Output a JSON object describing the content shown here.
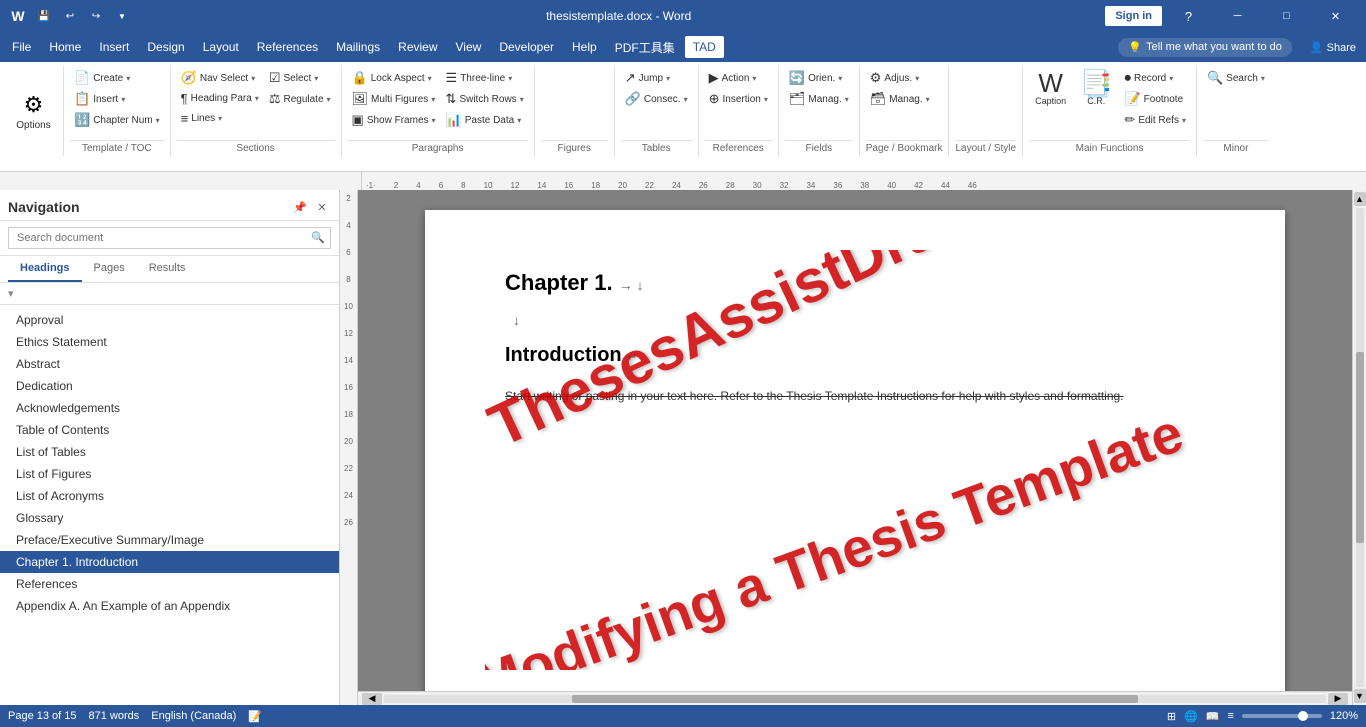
{
  "titlebar": {
    "title": "thesistemplate.docx - Word",
    "save_icon": "💾",
    "undo_icon": "↩",
    "redo_icon": "↪",
    "minimize": "─",
    "maximize": "□",
    "close": "✕",
    "signin": "Sign in"
  },
  "menubar": {
    "items": [
      "File",
      "Home",
      "Insert",
      "Design",
      "Layout",
      "References",
      "Mailings",
      "Review",
      "View",
      "Developer",
      "Help",
      "PDF工具集",
      "TAD"
    ],
    "active": "TAD",
    "tell_me": "Tell me what you want to do",
    "share": "Share"
  },
  "ribbon": {
    "tad_label": "TAD",
    "template_toc_label": "Template / TOC",
    "sections_label": "Sections",
    "paragraphs_label": "Paragraphs",
    "figures_label": "Figures",
    "tables_label": "Tables",
    "references_label": "References",
    "fields_label": "Fields",
    "page_bookmark_label": "Page / Bookmark",
    "layout_style_label": "Layout / Style",
    "main_functions_label": "Main Functions",
    "minor_label": "Minor",
    "options_label": "Options",
    "groups": {
      "tad": {
        "options": "Options"
      },
      "template_toc": {
        "create": "Create",
        "insert": "Insert",
        "chapter_num": "Chapter Num"
      },
      "sections": {
        "nav_select": "Nav Select",
        "heading_para": "Heading Para",
        "lines": "Lines",
        "select": "Select",
        "regulate": "Regulate"
      },
      "paragraphs": {
        "lock_aspect": "Lock Aspect",
        "multi_figures": "Multi Figures",
        "show_frames": "Show Frames",
        "three_line": "Three-line",
        "switch_rows": "Switch Rows",
        "paste_data": "Paste Data"
      },
      "figures": {},
      "tables": {
        "jump": "Jump",
        "consec": "Consec."
      },
      "references": {
        "action": "Action",
        "insertion": "Insertion"
      },
      "fields": {
        "orien": "Orien.",
        "manag": "Manag."
      },
      "page_bookmark": {
        "adjus": "Adjus.",
        "manag2": "Manag."
      },
      "layout_style": {},
      "main_functions": {
        "caption": "Caption",
        "cr": "C.R.",
        "record": "Record",
        "footnote": "Footnote",
        "edit_refs": "Edit Refs"
      },
      "minor": {
        "search": "Search"
      }
    }
  },
  "navigation": {
    "title": "Navigation",
    "search_placeholder": "Search document",
    "tabs": [
      "Headings",
      "Pages",
      "Results"
    ],
    "active_tab": "Headings",
    "items": [
      {
        "label": "Approval",
        "level": 1,
        "active": false
      },
      {
        "label": "Ethics Statement",
        "level": 1,
        "active": false
      },
      {
        "label": "Abstract",
        "level": 1,
        "active": false
      },
      {
        "label": "Dedication",
        "level": 1,
        "active": false
      },
      {
        "label": "Acknowledgements",
        "level": 1,
        "active": false
      },
      {
        "label": "Table of Contents",
        "level": 1,
        "active": false
      },
      {
        "label": "List of Tables",
        "level": 1,
        "active": false
      },
      {
        "label": "List of Figures",
        "level": 1,
        "active": false
      },
      {
        "label": "List of Acronyms",
        "level": 1,
        "active": false
      },
      {
        "label": "Glossary",
        "level": 1,
        "active": false
      },
      {
        "label": "Preface/Executive Summary/Image",
        "level": 1,
        "active": false
      },
      {
        "label": "Chapter 1.   Introduction",
        "level": 1,
        "active": true
      },
      {
        "label": "References",
        "level": 1,
        "active": false
      },
      {
        "label": "Appendix A.   An Example of an Appendix",
        "level": 1,
        "active": false
      }
    ]
  },
  "document": {
    "chapter_title": "Chapter 1.",
    "section_title": "Introduction",
    "body_text": "Start writing or pasting in your text here. Refer to the Thesis Template Instructions for help with styles and formatting.",
    "watermark1": "ThesesAssistDrawer",
    "watermark2": "Modifying a Thesis Template"
  },
  "statusbar": {
    "page": "Page 13 of 15",
    "words": "871 words",
    "language": "English (Canada)",
    "layout_icon": "⊞",
    "zoom": "120%"
  }
}
